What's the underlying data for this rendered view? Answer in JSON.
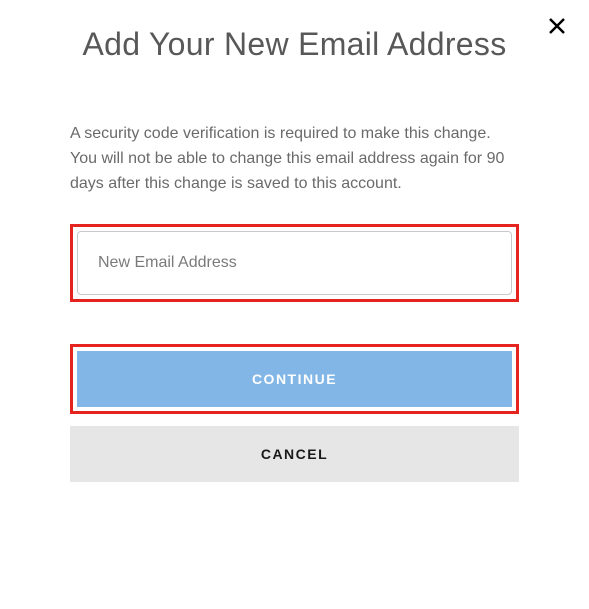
{
  "title": "Add Your New Email Address",
  "description": "A security code verification is required to make this change. You will not be able to change this email address again for 90 days after this change is saved to this account.",
  "emailInput": {
    "placeholder": "New Email Address",
    "value": ""
  },
  "buttons": {
    "continue": "CONTINUE",
    "cancel": "CANCEL"
  }
}
